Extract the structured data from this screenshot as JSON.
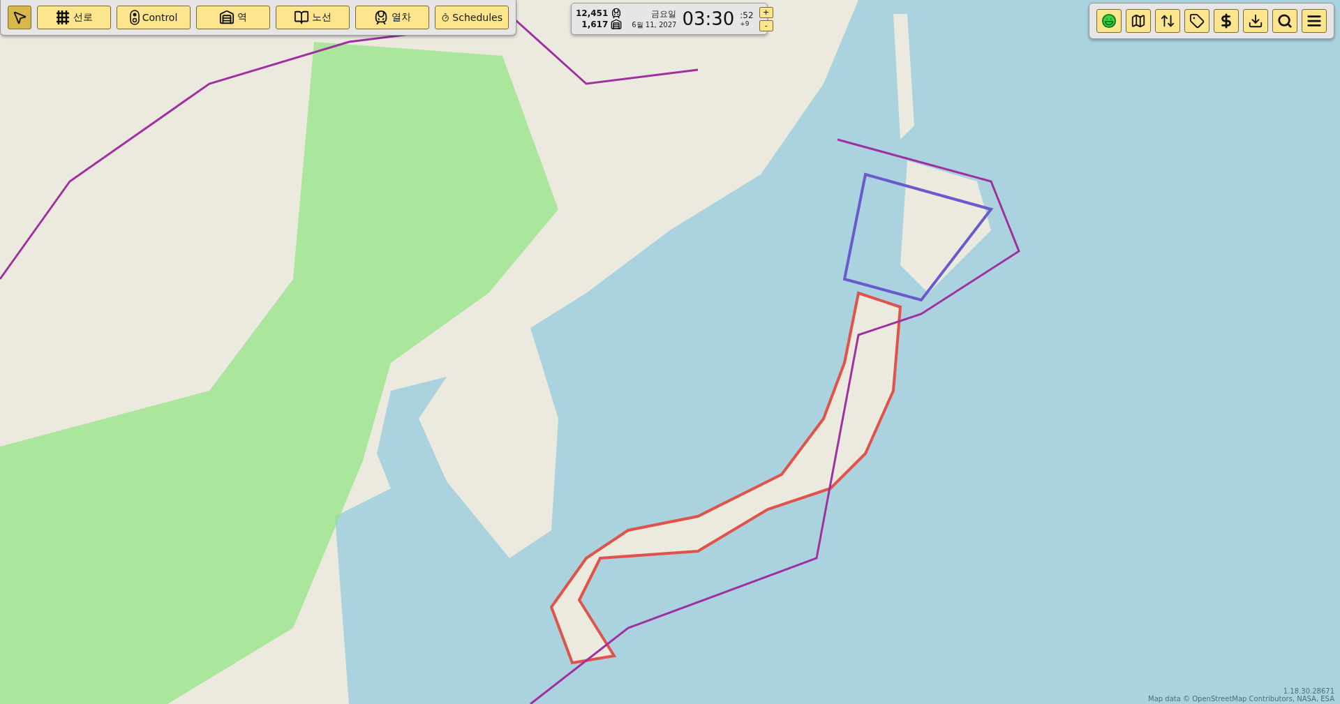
{
  "main_toolbar": {
    "select_tool": {
      "selected": true
    },
    "buttons": [
      {
        "kind": "tracks",
        "label": "선로",
        "selected": false
      },
      {
        "kind": "control",
        "label": "Control",
        "selected": false
      },
      {
        "kind": "station",
        "label": "역",
        "selected": false
      },
      {
        "kind": "lines",
        "label": "노선",
        "selected": false
      },
      {
        "kind": "train",
        "label": "열차",
        "selected": false
      },
      {
        "kind": "schedules",
        "label": "Schedules",
        "selected": false
      }
    ]
  },
  "status_panel": {
    "train_count": "12,451",
    "station_count": "1,617",
    "weekday": "금요일",
    "date": "6월 11, 2027",
    "time": "03:30",
    "seconds": ":52",
    "speed_offset": "+9",
    "speed_up": "+",
    "speed_down": "-"
  },
  "right_toolbar": [
    {
      "kind": "face"
    },
    {
      "kind": "map"
    },
    {
      "kind": "sort"
    },
    {
      "kind": "tag"
    },
    {
      "kind": "money"
    },
    {
      "kind": "download"
    },
    {
      "kind": "search"
    },
    {
      "kind": "menu"
    }
  ],
  "footer": {
    "version": "1.18.30.28671",
    "attribution": "Map data © OpenStreetMap Contributors, NASA, ESA"
  }
}
